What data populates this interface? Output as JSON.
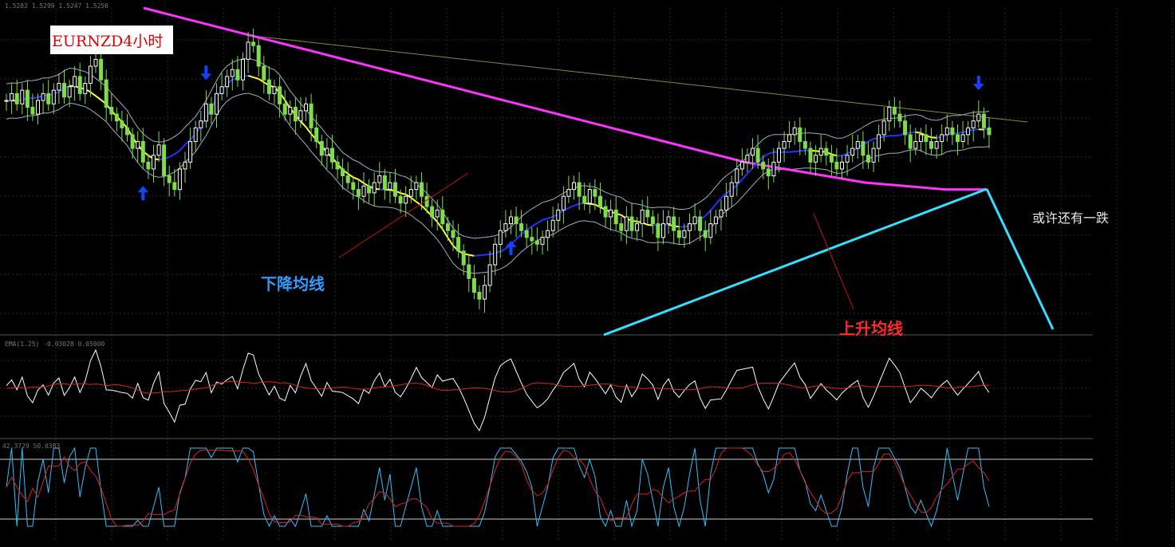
{
  "header": {
    "ohlc_text": "1.5282 1.5299 1.5247 1.5256",
    "chart_title": "EURNZD4小时"
  },
  "annotations": {
    "falling_ma": "下降均线",
    "rising_ma": "上升均线",
    "maybe_another_drop": "或许还有一跌"
  },
  "indicator_labels": {
    "panel1": "EMA(1.25) -0.03028 0.05000",
    "panel2": "42.3729 50.0383"
  },
  "colors": {
    "background": "#000000",
    "grid": "#2a2a2a",
    "candle_bull": "#ffffff",
    "candle_bear": "#7fdc4c",
    "ma_long": "#ff33ff",
    "ma_mid_falling": "#ffff33",
    "ma_mid_rising": "#2233ff",
    "envelope": "#9ab0c4",
    "resistance_line": "#8a8a3a",
    "trend_line": "#33e0ff",
    "arrow": "#1144ff",
    "osc_fast": "#ffffff",
    "osc_slow": "#dd2222",
    "stoch_main": "#33c0ff",
    "stoch_signal": "#dd2222"
  },
  "chart_data": {
    "type": "candlestick",
    "symbol": "EURNZD",
    "timeframe": "H4",
    "x": [
      0,
      1,
      2,
      3,
      4,
      5,
      6,
      7,
      8,
      9,
      10,
      11,
      12,
      13,
      14,
      15,
      16,
      17,
      18,
      19,
      20,
      21,
      22,
      23,
      24,
      25,
      26,
      27,
      28,
      29,
      30,
      31,
      32,
      33,
      34,
      35,
      36,
      37,
      38,
      39,
      40,
      41,
      42,
      43,
      44,
      45,
      46,
      47,
      48,
      49,
      50,
      51,
      52,
      53,
      54,
      55,
      56,
      57,
      58,
      59,
      60,
      61,
      62,
      63,
      64,
      65,
      66,
      67,
      68,
      69,
      70,
      71,
      72,
      73,
      74,
      75,
      76,
      77,
      78,
      79,
      80,
      81,
      82,
      83,
      84,
      85,
      86,
      87,
      88,
      89,
      90,
      91,
      92,
      93,
      94,
      95,
      96,
      97,
      98,
      99,
      100,
      101,
      102,
      103,
      104,
      105,
      106,
      107,
      108,
      109,
      110,
      111,
      112,
      113,
      114,
      115,
      116,
      117,
      118,
      119,
      120,
      121,
      122,
      123,
      124,
      125,
      126,
      127,
      128,
      129,
      130,
      131,
      132,
      133,
      134,
      135,
      136,
      137,
      138,
      139,
      140,
      141,
      142,
      143,
      144,
      145,
      146,
      147,
      148,
      149,
      150,
      151,
      152,
      153,
      154,
      155,
      156,
      157,
      158,
      159,
      160,
      161,
      162,
      163,
      164,
      165,
      166,
      167,
      168,
      169,
      170,
      171,
      172,
      173,
      174,
      175,
      176,
      177,
      178,
      179,
      180,
      181,
      182,
      183,
      184,
      185,
      186,
      187,
      188,
      189,
      190,
      191,
      192,
      193,
      194,
      195,
      196,
      197,
      198,
      199,
      200,
      201,
      202,
      203,
      204,
      205,
      206,
      207,
      208,
      209,
      210
    ],
    "close": [
      98,
      100,
      97,
      101,
      96,
      94,
      98,
      100,
      97,
      101,
      103,
      99,
      102,
      105,
      100,
      103,
      108,
      110,
      104,
      96,
      94,
      92,
      90,
      88,
      84,
      86,
      80,
      78,
      82,
      85,
      76,
      74,
      72,
      78,
      80,
      86,
      90,
      92,
      97,
      94,
      100,
      102,
      105,
      107,
      104,
      110,
      115,
      114,
      108,
      104,
      100,
      102,
      97,
      94,
      96,
      92,
      95,
      97,
      90,
      86,
      82,
      84,
      80,
      78,
      76,
      74,
      72,
      70,
      73,
      71,
      74,
      76,
      72,
      74,
      70,
      68,
      70,
      72,
      74,
      70,
      67,
      64,
      66,
      62,
      60,
      58,
      54,
      50,
      46,
      42,
      40,
      44,
      50,
      56,
      60,
      62,
      64,
      62,
      60,
      58,
      57,
      56,
      58,
      60,
      63,
      66,
      70,
      72,
      74,
      70,
      68,
      72,
      70,
      67,
      64,
      66,
      62,
      60,
      64,
      60,
      62,
      66,
      64,
      62,
      58,
      62,
      64,
      60,
      58,
      60,
      62,
      64,
      60,
      58,
      62,
      64,
      66,
      70,
      74,
      78,
      80,
      82,
      84,
      80,
      78,
      76,
      80,
      84,
      86,
      88,
      90,
      86,
      84,
      80,
      82,
      84,
      82,
      80,
      78,
      80,
      82,
      84,
      86,
      82,
      80,
      84,
      88,
      92,
      96,
      94,
      92,
      88,
      84,
      86,
      88,
      86,
      84,
      86,
      88,
      90,
      88,
      86,
      88,
      90,
      92,
      94,
      90,
      88
    ],
    "moving_averages": {
      "ma_long": [
        125,
        122,
        119,
        116,
        113,
        110,
        107,
        104,
        101,
        98,
        95,
        92,
        89,
        86,
        83,
        80,
        78,
        76,
        74,
        73,
        72,
        72
      ],
      "ma_mid": [
        92,
        93,
        95,
        96,
        97,
        95,
        92,
        90,
        90,
        91,
        92,
        94,
        96,
        94,
        88,
        82,
        76,
        70,
        66,
        63,
        62,
        62,
        64,
        67,
        70,
        73,
        76,
        80,
        84,
        88,
        92,
        95,
        96,
        97
      ]
    },
    "arrows": [
      {
        "bar": 38,
        "direction": "down"
      },
      {
        "bar": 96,
        "direction": "up"
      },
      {
        "bar": 26,
        "direction": "up"
      },
      {
        "bar": 185,
        "direction": "down"
      }
    ],
    "indicator_1": {
      "name": "EMA(1.25)",
      "values": [
        -0.03028,
        0.05
      ]
    },
    "indicator_2": {
      "name": "Stochastic",
      "values": [
        42.3729,
        50.0383
      ],
      "levels": [
        80,
        20
      ]
    },
    "grid": true
  }
}
